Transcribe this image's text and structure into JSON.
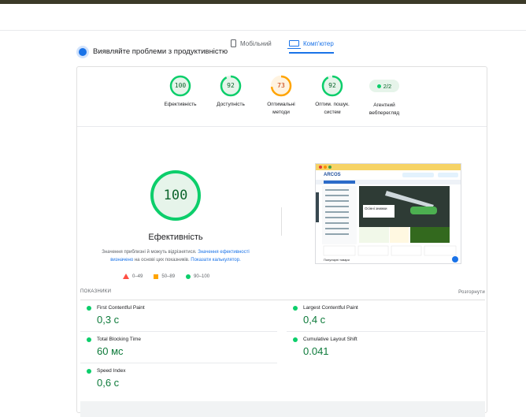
{
  "tabs": [
    {
      "label": "Мобільний",
      "active": false
    },
    {
      "label": "Комп'ютер",
      "active": true
    }
  ],
  "diagnose_title": "Виявляйте проблеми з продуктивністю",
  "categories": [
    {
      "score": "100",
      "label": "Ефективність",
      "color": "#0cce6b"
    },
    {
      "score": "92",
      "label": "Доступність",
      "color": "#0cce6b"
    },
    {
      "score": "73",
      "label": "Оптимальні методи",
      "color": "#ffa400"
    },
    {
      "score": "92",
      "label": "Оптим. пошук. систем",
      "color": "#0cce6b"
    },
    {
      "score": "2/2",
      "label": "Агентний вебперегляд",
      "color": "#0cce6b"
    }
  ],
  "main_score": {
    "value": "100",
    "title": "Ефективність",
    "fraction": 1.0
  },
  "note": {
    "p1": "Значення приблизні й можуть відрізнятися.",
    "link1": "Значення ефективності визначено",
    "p2": "на основі цих показників.",
    "link2": "Показати калькулятор."
  },
  "legend": {
    "fail": "0–49",
    "average": "50–89",
    "pass": "90–100"
  },
  "screenshot": {
    "brand": "ARCOS",
    "banner_text": "Осінні знижки",
    "section_title": "Популярні товари"
  },
  "metrics_header": "ПОКАЗНИКИ",
  "expand_label": "Розгорнути",
  "metrics": [
    {
      "name": "First Contentful Paint",
      "value": "0,3 с"
    },
    {
      "name": "Largest Contentful Paint",
      "value": "0,4 с"
    },
    {
      "name": "Total Blocking Time",
      "value": "60 мс"
    },
    {
      "name": "Cumulative Layout Shift",
      "value": "0.041"
    },
    {
      "name": "Speed Index",
      "value": "0,6 с"
    }
  ],
  "colors": {
    "pass": "#0cce6b",
    "average": "#ffa400",
    "fail": "#ff4e42",
    "accent": "#1a73e8"
  }
}
